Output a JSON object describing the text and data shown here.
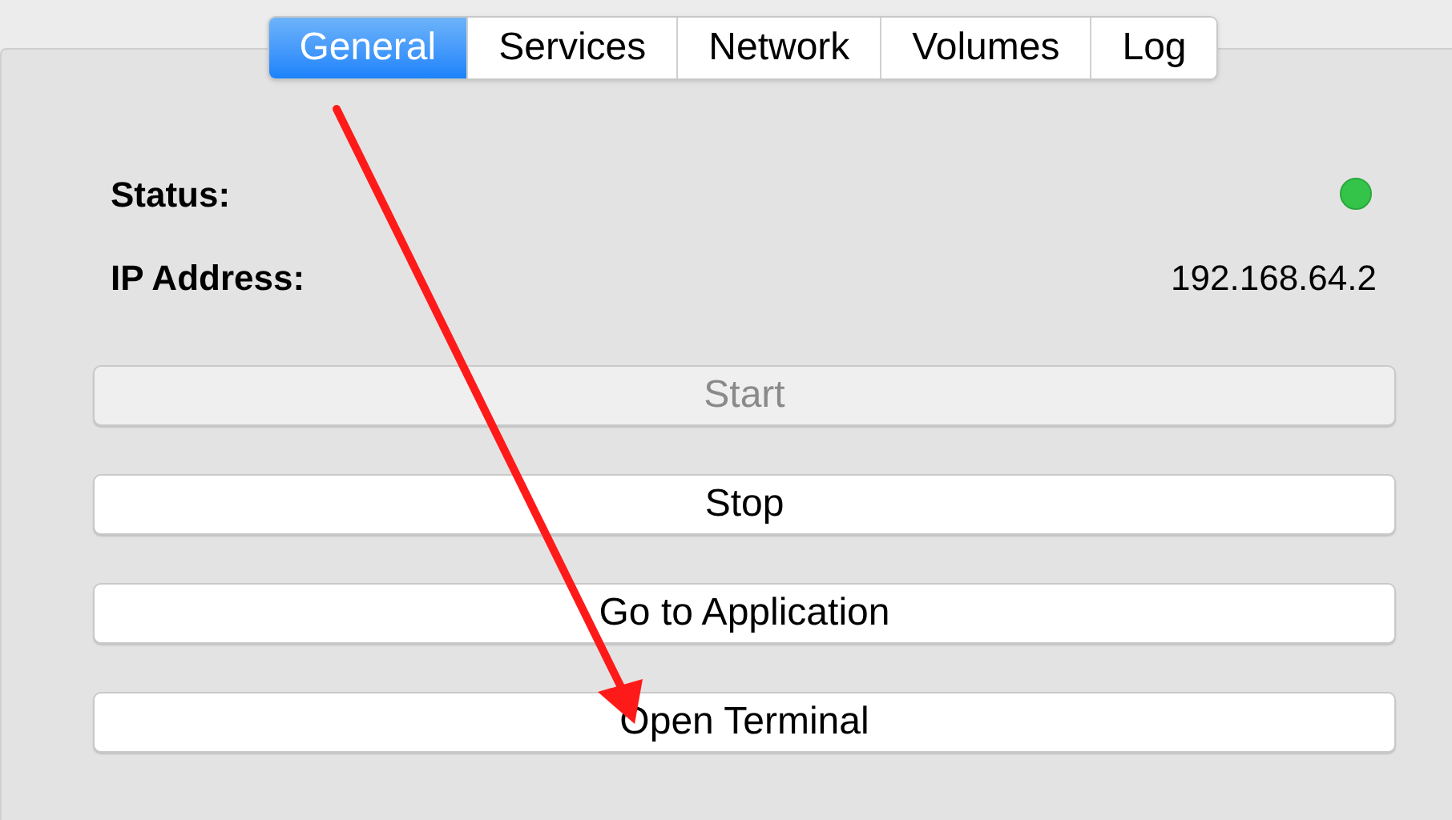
{
  "tabs": [
    {
      "label": "General",
      "selected": true
    },
    {
      "label": "Services",
      "selected": false
    },
    {
      "label": "Network",
      "selected": false
    },
    {
      "label": "Volumes",
      "selected": false
    },
    {
      "label": "Log",
      "selected": false
    }
  ],
  "status": {
    "label": "Status:",
    "on": true
  },
  "ip_address": {
    "label": "IP Address:",
    "value": "192.168.64.2"
  },
  "buttons": [
    {
      "label": "Start",
      "disabled": true
    },
    {
      "label": "Stop",
      "disabled": false
    },
    {
      "label": "Go to Application",
      "disabled": false
    },
    {
      "label": "Open Terminal",
      "disabled": false
    }
  ]
}
